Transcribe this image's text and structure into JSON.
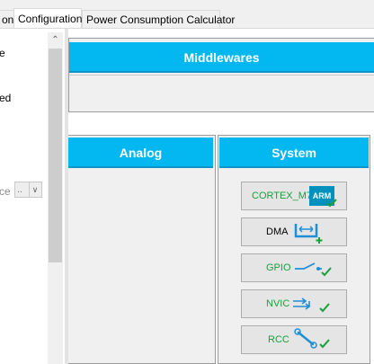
{
  "tabs": [
    {
      "label": "on",
      "active": false
    },
    {
      "label": "Configuration",
      "active": true
    },
    {
      "label": "Power Consumption Calculator",
      "active": false
    }
  ],
  "left_panel": {
    "text_1": "e",
    "text_2": "ed",
    "text_3": "ce",
    "select_value": ".."
  },
  "middlewares": {
    "title": "Middlewares"
  },
  "analog": {
    "title": "Analog"
  },
  "system": {
    "title": "System",
    "items": [
      {
        "label": "CORTEX_M7",
        "status": "ok",
        "icon": "arm-logo-icon",
        "logo_text": "ARM"
      },
      {
        "label": "DMA",
        "status": "none",
        "icon": "dma-icon"
      },
      {
        "label": "GPIO",
        "status": "ok",
        "icon": "gpio-switch-icon"
      },
      {
        "label": "NVIC",
        "status": "ok",
        "icon": "nvic-arrows-icon"
      },
      {
        "label": "RCC",
        "status": "ok",
        "icon": "wrench-icon"
      }
    ]
  },
  "colors": {
    "header_blue": "#03b8f1",
    "ok_green": "#19a03c",
    "icon_blue": "#1e8fd6"
  }
}
